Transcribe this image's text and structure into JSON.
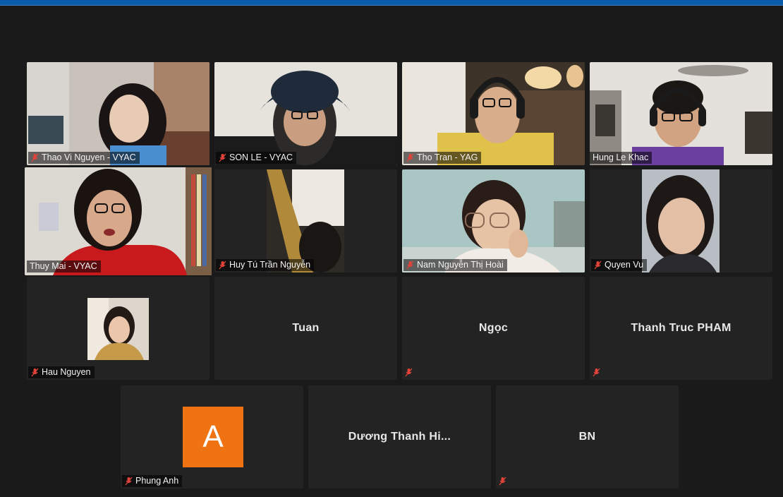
{
  "participants": [
    {
      "name": "Thao Vi Nguyen - VYAC",
      "muted": true
    },
    {
      "name": "SON LE - VYAC",
      "muted": true
    },
    {
      "name": "Tho Tran - YAG",
      "muted": true
    },
    {
      "name": "Hung Le Khac",
      "muted": false
    },
    {
      "name": "Thuy Mai - VYAC",
      "muted": false
    },
    {
      "name": "Huy Tú Trần Nguyễn",
      "muted": true
    },
    {
      "name": "Nam Nguyễn Thị Hoài",
      "muted": true
    },
    {
      "name": "Quyen Vu",
      "muted": true
    },
    {
      "name": "Hau Nguyen",
      "muted": true
    },
    {
      "name": "Tuan",
      "muted": false
    },
    {
      "name": "Ngọc",
      "muted": true
    },
    {
      "name": "Thanh Truc PHAM",
      "muted": true
    },
    {
      "name": "Phung Anh",
      "muted": true,
      "avatar_letter": "A"
    },
    {
      "name": "Dương Thanh Hi...",
      "muted": false
    },
    {
      "name": "BN",
      "muted": true
    }
  ],
  "colors": {
    "active_speaker_border": "#d4e04a",
    "muted_icon": "#e0433a",
    "avatar_orange": "#ef7313",
    "background": "#1a1a1a",
    "tile": "#232323"
  },
  "icons": {
    "muted": "muted-mic-icon"
  }
}
